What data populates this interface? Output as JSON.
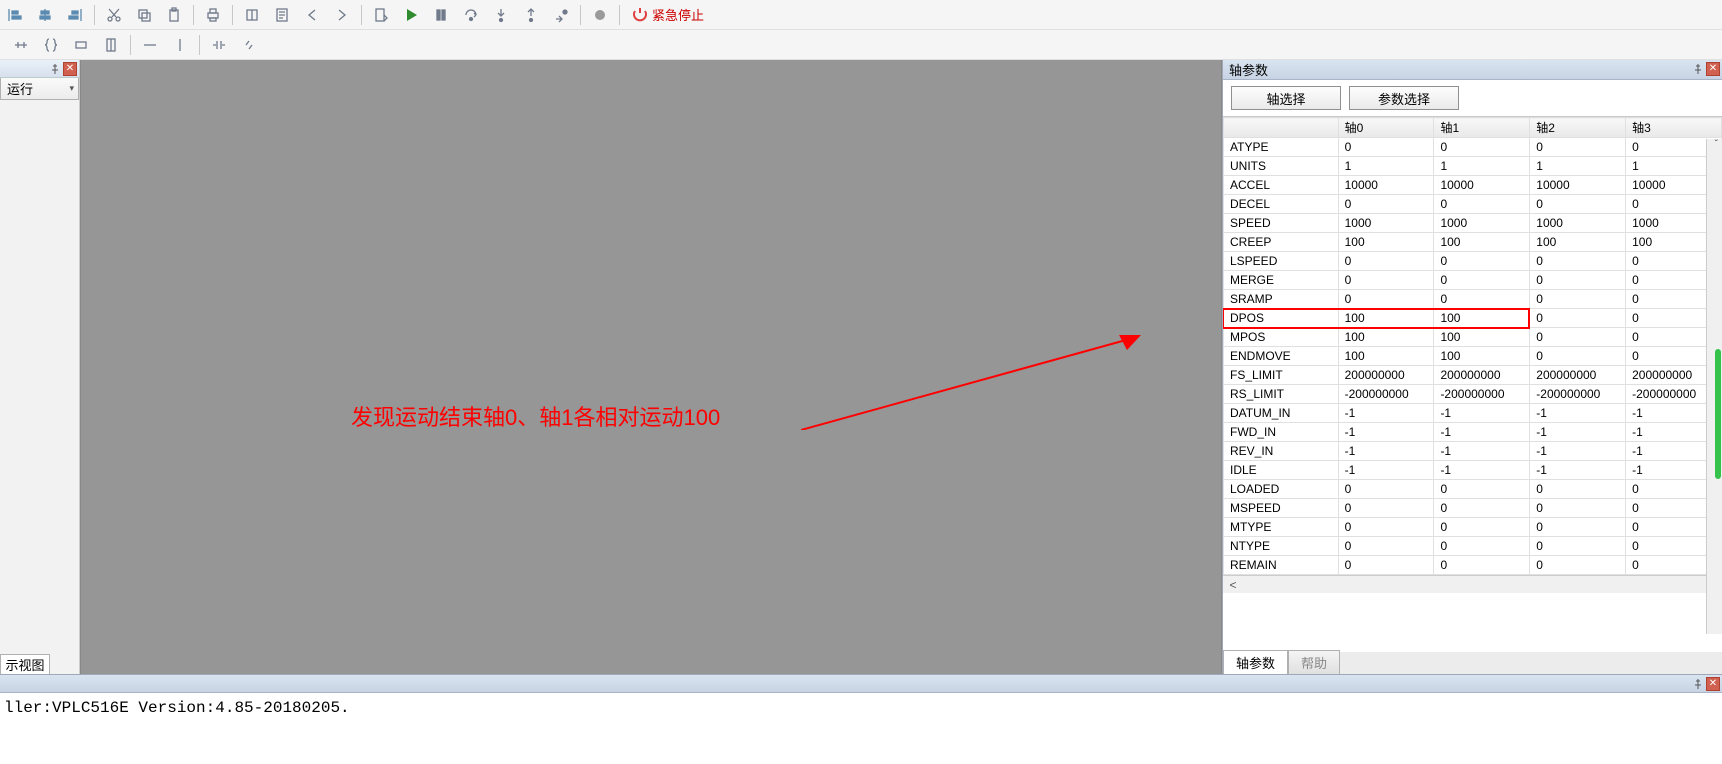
{
  "toolbar": {
    "emergency_label": "紧急停止"
  },
  "left": {
    "tab_label": "运行",
    "bottom_tab_label": "示视图"
  },
  "annotation": {
    "text": "发现运动结束轴0、轴1各相对运动100"
  },
  "right": {
    "title": "轴参数",
    "select_axis": "轴选择",
    "select_param": "参数选择",
    "columns": [
      "",
      "轴0",
      "轴1",
      "轴2",
      "轴3"
    ],
    "rows": [
      {
        "name": "ATYPE",
        "v": [
          "0",
          "0",
          "0",
          "0"
        ]
      },
      {
        "name": "UNITS",
        "v": [
          "1",
          "1",
          "1",
          "1"
        ]
      },
      {
        "name": "ACCEL",
        "v": [
          "10000",
          "10000",
          "10000",
          "10000"
        ]
      },
      {
        "name": "DECEL",
        "v": [
          "0",
          "0",
          "0",
          "0"
        ]
      },
      {
        "name": "SPEED",
        "v": [
          "1000",
          "1000",
          "1000",
          "1000"
        ]
      },
      {
        "name": "CREEP",
        "v": [
          "100",
          "100",
          "100",
          "100"
        ]
      },
      {
        "name": "LSPEED",
        "v": [
          "0",
          "0",
          "0",
          "0"
        ]
      },
      {
        "name": "MERGE",
        "v": [
          "0",
          "0",
          "0",
          "0"
        ]
      },
      {
        "name": "SRAMP",
        "v": [
          "0",
          "0",
          "0",
          "0"
        ]
      },
      {
        "name": "DPOS",
        "v": [
          "100",
          "100",
          "0",
          "0"
        ]
      },
      {
        "name": "MPOS",
        "v": [
          "100",
          "100",
          "0",
          "0"
        ]
      },
      {
        "name": "ENDMOVE",
        "v": [
          "100",
          "100",
          "0",
          "0"
        ]
      },
      {
        "name": "FS_LIMIT",
        "v": [
          "200000000",
          "200000000",
          "200000000",
          "200000000"
        ]
      },
      {
        "name": "RS_LIMIT",
        "v": [
          "-200000000",
          "-200000000",
          "-200000000",
          "-200000000"
        ]
      },
      {
        "name": "DATUM_IN",
        "v": [
          "-1",
          "-1",
          "-1",
          "-1"
        ]
      },
      {
        "name": "FWD_IN",
        "v": [
          "-1",
          "-1",
          "-1",
          "-1"
        ]
      },
      {
        "name": "REV_IN",
        "v": [
          "-1",
          "-1",
          "-1",
          "-1"
        ]
      },
      {
        "name": "IDLE",
        "v": [
          "-1",
          "-1",
          "-1",
          "-1"
        ]
      },
      {
        "name": "LOADED",
        "v": [
          "0",
          "0",
          "0",
          "0"
        ]
      },
      {
        "name": "MSPEED",
        "v": [
          "0",
          "0",
          "0",
          "0"
        ]
      },
      {
        "name": "MTYPE",
        "v": [
          "0",
          "0",
          "0",
          "0"
        ]
      },
      {
        "name": "NTYPE",
        "v": [
          "0",
          "0",
          "0",
          "0"
        ]
      },
      {
        "name": "REMAIN",
        "v": [
          "0",
          "0",
          "0",
          "0"
        ]
      }
    ],
    "bottom_tab_active": "轴参数",
    "bottom_tab_inactive": "帮助"
  },
  "output": {
    "line": "ller:VPLC516E Version:4.85-20180205."
  }
}
